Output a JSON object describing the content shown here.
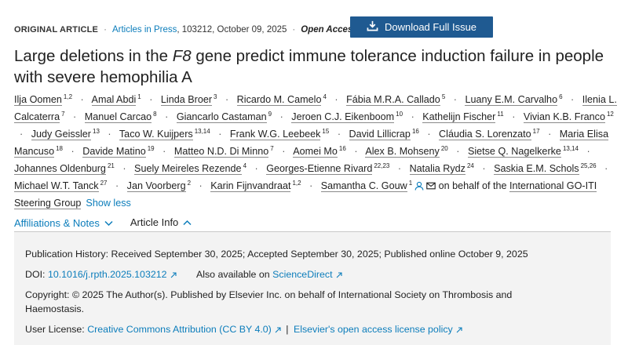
{
  "meta": {
    "article_type": "ORIGINAL ARTICLE",
    "journal_section": "Articles in Press",
    "article_info": ", 103212, October 09, 2025",
    "access": "Open Access"
  },
  "download_button": {
    "label": "Download Full Issue",
    "icon": "download-icon"
  },
  "title": {
    "part1": "Large deletions in the ",
    "gene": "F8",
    "part2": " gene predict immune tolerance induction failure in people with severe hemophilia A"
  },
  "authors": [
    {
      "name": "Ilja Oomen",
      "aff": "1,2"
    },
    {
      "name": "Amal Abdi",
      "aff": "1"
    },
    {
      "name": "Linda Broer",
      "aff": "3"
    },
    {
      "name": "Ricardo M. Camelo",
      "aff": "4"
    },
    {
      "name": "Fábia M.R.A. Callado",
      "aff": "5"
    },
    {
      "name": "Luany E.M. Carvalho",
      "aff": "6"
    },
    {
      "name": "Ilenia L. Calcaterra",
      "aff": "7"
    },
    {
      "name": "Manuel Carcao",
      "aff": "8"
    },
    {
      "name": "Giancarlo Castaman",
      "aff": "9"
    },
    {
      "name": "Jeroen C.J. Eikenboom",
      "aff": "10"
    },
    {
      "name": "Kathelijn Fischer",
      "aff": "11"
    },
    {
      "name": "Vivian K.B. Franco",
      "aff": "12"
    },
    {
      "name": "Judy Geissler",
      "aff": "13"
    },
    {
      "name": "Taco W. Kuijpers",
      "aff": "13,14"
    },
    {
      "name": "Frank W.G. Leebeek",
      "aff": "15"
    },
    {
      "name": "David Lillicrap",
      "aff": "16"
    },
    {
      "name": "Cláudia S. Lorenzato",
      "aff": "17"
    },
    {
      "name": "Maria Elisa Mancuso",
      "aff": "18"
    },
    {
      "name": "Davide Matino",
      "aff": "19"
    },
    {
      "name": "Matteo N.D. Di Minno",
      "aff": "7"
    },
    {
      "name": "Aomei Mo",
      "aff": "16"
    },
    {
      "name": "Alex B. Mohseny",
      "aff": "20"
    },
    {
      "name": "Sietse Q. Nagelkerke",
      "aff": "13,14"
    },
    {
      "name": "Johannes Oldenburg",
      "aff": "21"
    },
    {
      "name": "Suely Meireles Rezende",
      "aff": "4"
    },
    {
      "name": "Georges-Etienne Rivard",
      "aff": "22,23"
    },
    {
      "name": "Natalia Rydz",
      "aff": "24"
    },
    {
      "name": "Saskia E.M. Schols",
      "aff": "25,26"
    },
    {
      "name": "Michael W.T. Tanck",
      "aff": "27"
    },
    {
      "name": "Jan Voorberg",
      "aff": "2"
    },
    {
      "name": "Karin Fijnvandraat",
      "aff": "1,2"
    },
    {
      "name": "Samantha C. Gouw",
      "aff": "1",
      "corresponding": true
    }
  ],
  "authors_tail": {
    "behalf_prefix": " on behalf of the ",
    "group": "International GO-ITI Steering Group",
    "show_less": "Show less",
    "icons": [
      "person-icon",
      "envelope-icon"
    ]
  },
  "tabs": [
    {
      "label": "Affiliations & Notes",
      "icon": "chevron-down-icon",
      "active": false
    },
    {
      "label": "Article Info",
      "icon": "chevron-up-icon",
      "active": true
    }
  ],
  "article_info": {
    "history_label": "Publication History:",
    "history_value": "Received September 30, 2025; Accepted September 30, 2025; Published online October 9, 2025",
    "doi_label": "DOI:",
    "doi_value": "10.1016/j.rpth.2025.103212",
    "also_label": "Also available on",
    "also_link": "ScienceDirect",
    "copyright_label": "Copyright:",
    "copyright_value": "© 2025 The Author(s). Published by Elsevier Inc. on behalf of International Society on Thrombosis and Haemostasis.",
    "license_label": "User License:",
    "license_link": "Creative Commons Attribution (CC BY 4.0)",
    "license_sep": "|",
    "policy_link": "Elsevier's open access license policy"
  },
  "colors": {
    "link": "#0c7dbb",
    "button": "#1f5a91",
    "panel": "#f3f3f3"
  }
}
